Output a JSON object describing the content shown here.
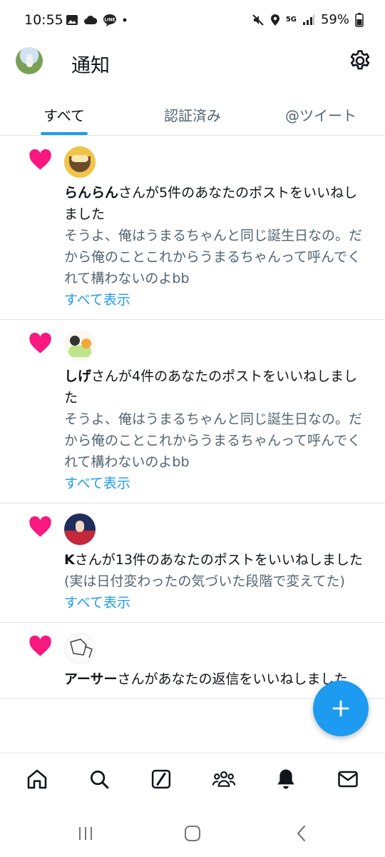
{
  "status_bar": {
    "time": "10:55",
    "network": "5G",
    "battery": "59%"
  },
  "header": {
    "title": "通知"
  },
  "tabs": [
    {
      "label": "すべて",
      "active": true
    },
    {
      "label": "認証済み",
      "active": false
    },
    {
      "label": "@ツイート",
      "active": false
    }
  ],
  "notifications": [
    {
      "user": "らんらん",
      "action": "さんが5件のあなたのポストをいいねしました",
      "body": "そうよ、俺はうまるちゃんと同じ誕生日なの。だから俺のことこれからうまるちゃんって呼んでくれて構わないのよbb",
      "more": "すべて表示"
    },
    {
      "user": "しげ",
      "action": "さんが4件のあなたのポストをいいねしました",
      "body": "そうよ、俺はうまるちゃんと同じ誕生日なの。だから俺のことこれからうまるちゃんって呼んでくれて構わないのよbb",
      "more": "すべて表示"
    },
    {
      "user": "K",
      "action": "さんが13件のあなたのポストをいいねしました",
      "body": "(実は日付変わったの気づいた段階で変えてた)",
      "more": "すべて表示"
    },
    {
      "user": "アーサー",
      "action": "さんがあなたの返信をいいねしました",
      "body": "",
      "more": ""
    }
  ],
  "colors": {
    "accent": "#1d9bf0",
    "like": "#f91880",
    "secondary_text": "#536471"
  },
  "icons": {
    "bottom_nav": [
      "home-icon",
      "search-icon",
      "grok-icon",
      "communities-icon",
      "notifications-icon",
      "messages-icon"
    ],
    "fab": "plus-icon"
  }
}
